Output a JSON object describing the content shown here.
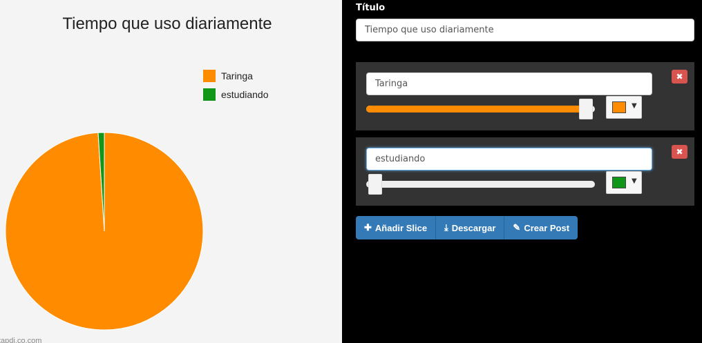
{
  "chart_data": {
    "type": "pie",
    "title": "Tiempo que uso diariamente",
    "categories": [
      "Taringa",
      "estudiando"
    ],
    "values": [
      99,
      1
    ],
    "colors": [
      "#ff8c00",
      "#109618"
    ],
    "legend_position": "top-right"
  },
  "watermark": "tapdi.co.com",
  "editor": {
    "title_label": "Título",
    "title_value": "Tiempo que uso diariamente",
    "slices": [
      {
        "name": "Taringa",
        "value": 99,
        "color": "#ff8c00",
        "remove_label": "✖"
      },
      {
        "name": "estudiando",
        "value": 1,
        "color": "#109618",
        "remove_label": "✖"
      }
    ],
    "actions": {
      "add_label": "Añadir Slice",
      "add_icon": "plus-icon",
      "download_label": "Descargar",
      "download_icon": "download-icon",
      "post_label": "Crear Post",
      "post_icon": "pencil-icon"
    }
  }
}
